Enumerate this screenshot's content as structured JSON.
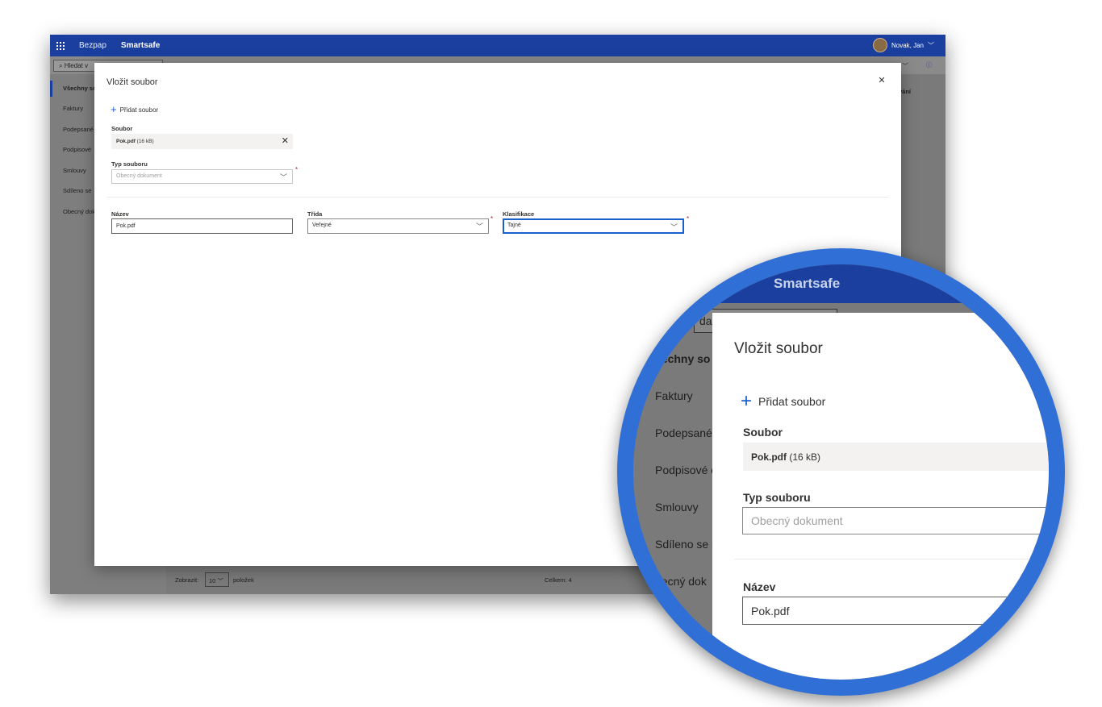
{
  "app": {
    "brand_primary": "Bezpap",
    "brand_secondary": "Smartsafe",
    "user_name": "Novak, Jan",
    "search_placeholder": "Hledat v",
    "colors": {
      "header": "#1a3f9e",
      "accent": "#1a5fd0",
      "lens_ring": "#2f6fd6",
      "required": "#a4262c"
    }
  },
  "sidebar": {
    "items": [
      {
        "label": "Všechny so"
      },
      {
        "label": "Faktury"
      },
      {
        "label": "Podepsané"
      },
      {
        "label": "Podpisové"
      },
      {
        "label": "Smlouvy"
      },
      {
        "label": "Sdíleno se"
      },
      {
        "label": "Obecný dok"
      }
    ]
  },
  "background": {
    "column_header_fragment": "vání",
    "view_fragment": "o",
    "footer": {
      "show_label": "Zobrazit:",
      "page_size": "10",
      "items_label": "položek",
      "total_label": "Celkem: 4"
    }
  },
  "dialog": {
    "title": "Vložit soubor",
    "close_icon": "close-icon",
    "add_file_label": "Přidat soubor",
    "file_label": "Soubor",
    "file_name": "Pok.pdf",
    "file_size": "(16 kB)",
    "file_type_label": "Typ souboru",
    "file_type_placeholder": "Obecný dokument",
    "name_label": "Název",
    "name_value": "Pok.pdf",
    "class_label": "Třída",
    "class_value": "Veřejné",
    "classification_label": "Klasifikace",
    "classification_value": "Tajné",
    "required_mark": "*"
  },
  "magnifier": {
    "brand": "Smartsafe",
    "search_fragment": "dat v",
    "sidebar_items": [
      "šechny so",
      "Faktury",
      "Podepsané",
      "Podpisové d",
      "Smlouvy",
      "Sdíleno se n",
      "becný dok"
    ]
  }
}
